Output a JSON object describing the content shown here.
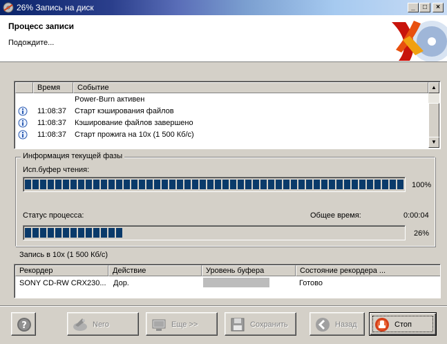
{
  "window": {
    "title": "26% Запись на диск"
  },
  "titlebar_buttons": {
    "minimize": "_",
    "maximize": "□",
    "close": "×"
  },
  "header": {
    "title": "Процесс записи",
    "subtitle": "Подождите..."
  },
  "log": {
    "columns": [
      "Время",
      "Событие"
    ],
    "rows": [
      {
        "icon": "",
        "time": "",
        "event": "Power-Burn активен"
      },
      {
        "icon": "info-icon",
        "time": "11:08:37",
        "event": "Старт кэширования файлов"
      },
      {
        "icon": "info-icon",
        "time": "11:08:37",
        "event": "Кэширование файлов завершено"
      },
      {
        "icon": "info-icon",
        "time": "11:08:37",
        "event": "Старт прожига на 10x (1 500 Кб/с)"
      }
    ]
  },
  "phase": {
    "group_title": "Информация текущей фазы",
    "buffer_label": "Исп.буфер чтения:",
    "buffer_percent_text": "100%",
    "buffer_fraction": 1.0,
    "process_label": "Статус процесса:",
    "total_time_label": "Общее время:",
    "total_time": "0:00:04",
    "process_percent_text": "26%",
    "process_fraction": 0.26
  },
  "status_line": "Запись в 10x (1 500 Кб/с)",
  "recorder_table": {
    "columns": [
      "Рекордер",
      "Действие",
      "Уровень буфера",
      "Состояние рекордера ..."
    ],
    "rows": [
      {
        "recorder": "SONY CD-RW  CRX230...",
        "action": "Дор.",
        "buffer_fraction": 1.0,
        "state": "Готово"
      }
    ]
  },
  "buttons": {
    "help": "",
    "nero": "Nero",
    "more": "Еще >>",
    "save": "Сохранить",
    "back": "Назад",
    "stop": "Стоп"
  },
  "colors": {
    "progress": "#0a3a6a",
    "titlebar": "#0a246a",
    "stop_icon": "#d4401a"
  }
}
